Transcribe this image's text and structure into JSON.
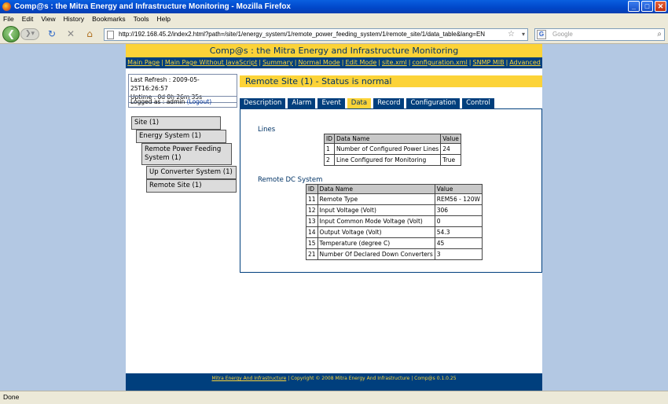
{
  "window": {
    "title": "Comp@s : the Mitra Energy and Infrastructure Monitoring - Mozilla Firefox"
  },
  "menu": [
    "File",
    "Edit",
    "View",
    "History",
    "Bookmarks",
    "Tools",
    "Help"
  ],
  "toolbar": {
    "url": "http://192.168.45.2/index2.html?path=/site/1/energy_system/1/remote_power_feeding_system/1/remote_site/1/data_table&lang=EN",
    "search_placeholder": "Google"
  },
  "header": {
    "title": "Comp@s : the Mitra Energy and Infrastructure Monitoring"
  },
  "nav_links": [
    "Main Page",
    "Main Page Without JavaScript",
    "Summary",
    "Normal Mode",
    "Edit Mode",
    "site.xml",
    "configuration.xml",
    "SNMP MIB",
    "Advanced"
  ],
  "info": {
    "last_refresh": "Last Refresh : 2009-05-25T16:26:57",
    "uptime": "Uptime : 0d 0h 26m 35s",
    "logged_as": "Logged as : admin",
    "logout": "(Logout)"
  },
  "tree": [
    "Site (1)",
    "Energy System (1)",
    "Remote Power Feeding System (1)",
    "Up Converter System (1)",
    "Remote Site (1)"
  ],
  "status_title": "Remote Site (1) - Status is normal",
  "tabs": [
    "Description",
    "Alarm",
    "Event",
    "Data",
    "Record",
    "Configuration",
    "Control"
  ],
  "active_tab": "Data",
  "lines": {
    "title": "Lines",
    "headers": [
      "ID",
      "Data Name",
      "Value"
    ],
    "rows": [
      [
        "1",
        "Number of Configured Power Lines",
        "24"
      ],
      [
        "2",
        "Line Configured for Monitoring",
        "True"
      ]
    ]
  },
  "remote_dc": {
    "title": "Remote DC System",
    "headers": [
      "ID",
      "Data Name",
      "Value"
    ],
    "rows": [
      [
        "11",
        "Remote Type",
        "REM56 - 120W"
      ],
      [
        "12",
        "Input Voltage (Volt)",
        "306"
      ],
      [
        "13",
        "Input Common Mode Voltage (Volt)",
        "0"
      ],
      [
        "14",
        "Output Voltage (Volt)",
        "54.3"
      ],
      [
        "15",
        "Temperature (degree C)",
        "45"
      ],
      [
        "21",
        "Number Of Declared Down Converters",
        "3"
      ]
    ]
  },
  "footer": {
    "link": "Mitra Energy And Infrastructure",
    "copyright": "Copyright © 2008 Mitra Energy And Infrastructure",
    "version": "Comp@s 0.1.0.25"
  },
  "statusbar": {
    "text": "Done"
  },
  "colors": {
    "accent_yellow": "#fcd338",
    "navy": "#003f7d",
    "page_bg": "#b3c8e3"
  }
}
